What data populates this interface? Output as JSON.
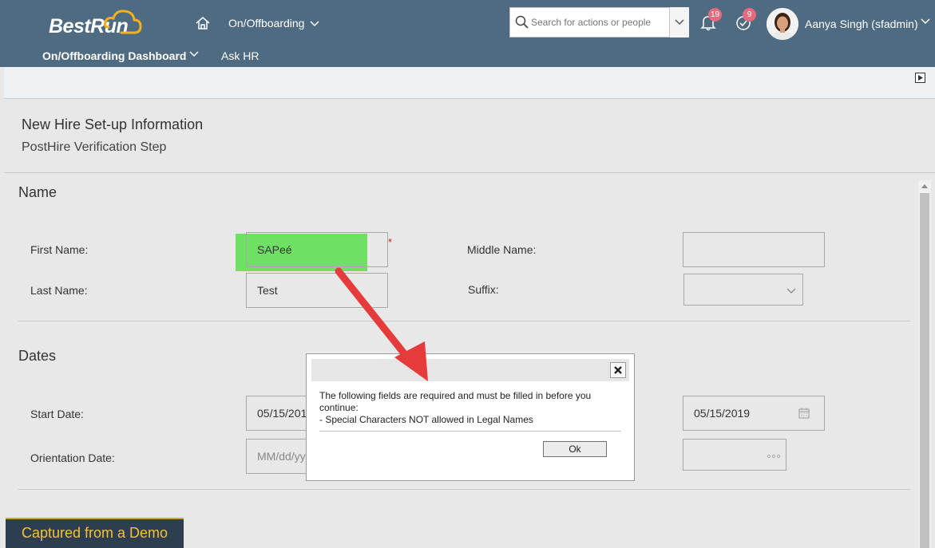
{
  "header": {
    "logo": "BestRun",
    "module": "On/Offboarding",
    "search_placeholder": "Search for actions or people",
    "notifications_count": "19",
    "todo_count": "9",
    "user_name": "Aanya Singh (sfadmin)",
    "nav": [
      "On/Offboarding Dashboard",
      "Ask HR"
    ]
  },
  "page": {
    "title": "New Hire Set-up Information",
    "subtitle": "PostHire Verification Step"
  },
  "name_section": {
    "heading": "Name",
    "first_name_label": "First Name:",
    "first_name_value": "SAPeé",
    "required_marker": "*",
    "middle_name_label": "Middle Name:",
    "middle_name_value": "",
    "last_name_label": "Last Name:",
    "last_name_value": "Test",
    "suffix_label": "Suffix:",
    "suffix_value": ""
  },
  "dates_section": {
    "heading": "Dates",
    "start_date_label": "Start Date:",
    "start_date_value": "05/15/201",
    "start_date_right_value": "05/15/2019",
    "orientation_date_label": "Orientation Date:",
    "orientation_date_placeholder": "MM/dd/yy"
  },
  "dialog": {
    "message_line1": "The following fields are required and must be filled in before you continue:",
    "message_line2": "- Special Characters NOT allowed in Legal Names",
    "ok_label": "Ok"
  },
  "banner": "Captured from a Demo",
  "colors": {
    "header_bg": "#4e6b82",
    "highlight": "#6ee063",
    "arrow": "#e63b3b",
    "badge": "#e7697e",
    "banner_text": "#f2c23a"
  }
}
